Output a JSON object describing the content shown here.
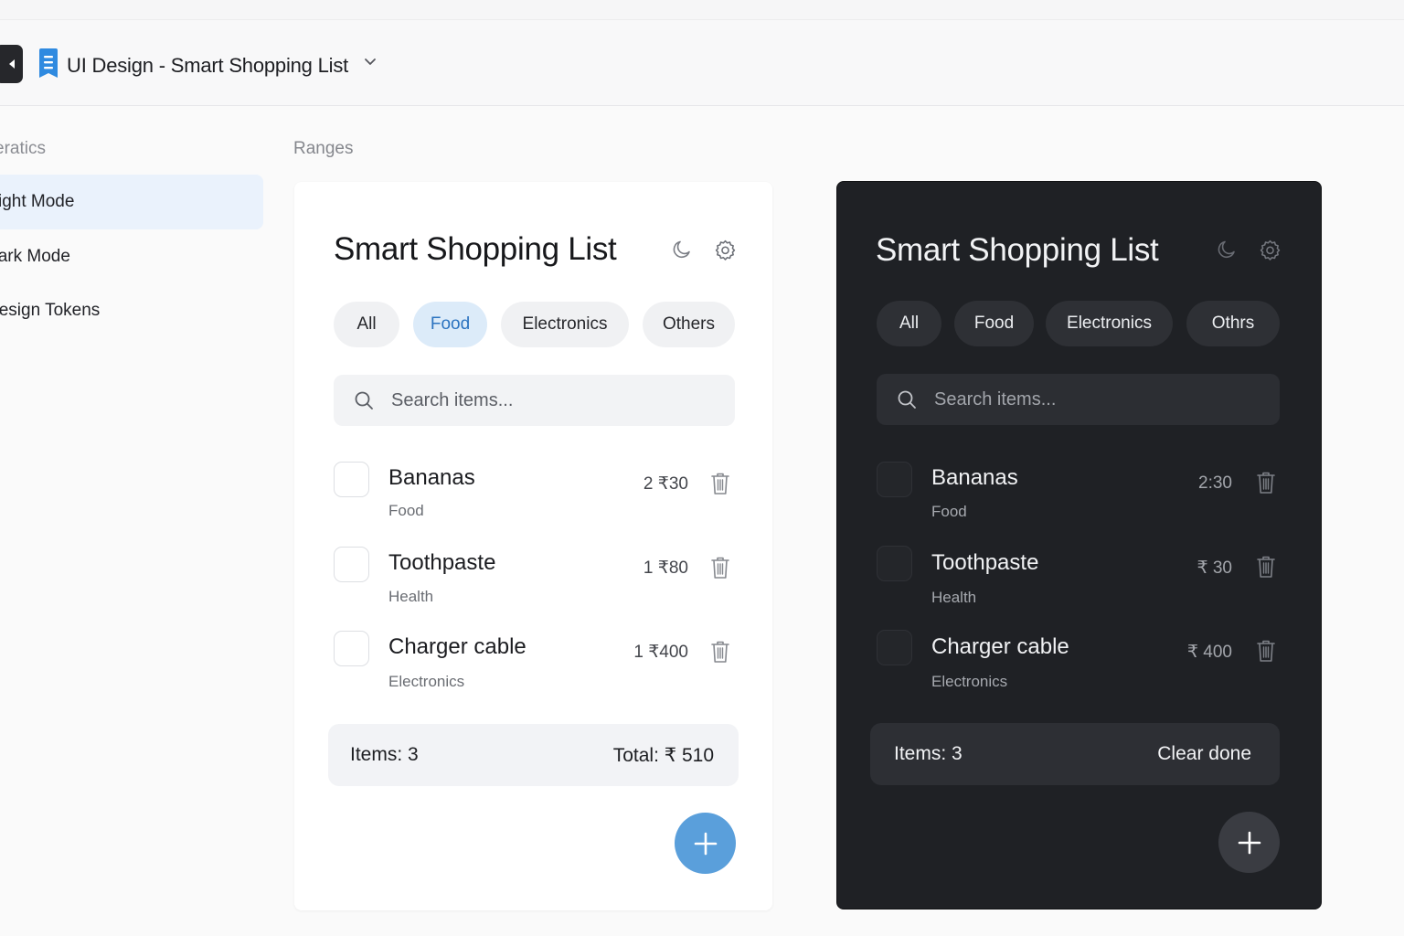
{
  "header": {
    "doc_title": "UI Design - Smart Shopping List"
  },
  "sidebar": {
    "heading": "eratics",
    "items": [
      {
        "label": "ight Mode",
        "active": true
      },
      {
        "label": "Dark Mode",
        "active": false
      },
      {
        "label": "Design Tokens",
        "active": false
      }
    ]
  },
  "main": {
    "heading": "Ranges"
  },
  "light": {
    "title": "Smart Shopping List",
    "chips": [
      "All",
      "Food",
      "Electronics",
      "Others"
    ],
    "selected_chip": "Food",
    "search_placeholder": "Search items...",
    "items": [
      {
        "name": "Bananas",
        "category": "Food",
        "value": "2 ₹30"
      },
      {
        "name": "Toothpaste",
        "category": "Health",
        "value": "1 ₹80"
      },
      {
        "name": "Charger cable",
        "category": "Electronics",
        "value": "1 ₹400"
      }
    ],
    "footer_left": "Items: 3",
    "footer_right": "Total: ₹ 510",
    "accent": "#5a9fdb"
  },
  "dark": {
    "title": "Smart Shopping List",
    "chips": [
      "All",
      "Food",
      "Electronics",
      "Othrs"
    ],
    "search_placeholder": "Search items...",
    "items": [
      {
        "name": "Bananas",
        "category": "Food",
        "value": "2:30"
      },
      {
        "name": "Toothpaste",
        "category": "Health",
        "value": "₹ 30"
      },
      {
        "name": "Charger cable",
        "category": "Electronics",
        "value": "₹ 400"
      }
    ],
    "footer_left": "Items: 3",
    "footer_right": "Clear done",
    "background": "#1f2125"
  },
  "icons": {
    "back": "chevron-left-icon",
    "doc": "document-icon",
    "dropdown": "chevron-down-icon",
    "theme": "moon-icon",
    "settings": "gear-icon",
    "search": "search-icon",
    "delete": "trash-icon",
    "add": "plus-icon"
  }
}
